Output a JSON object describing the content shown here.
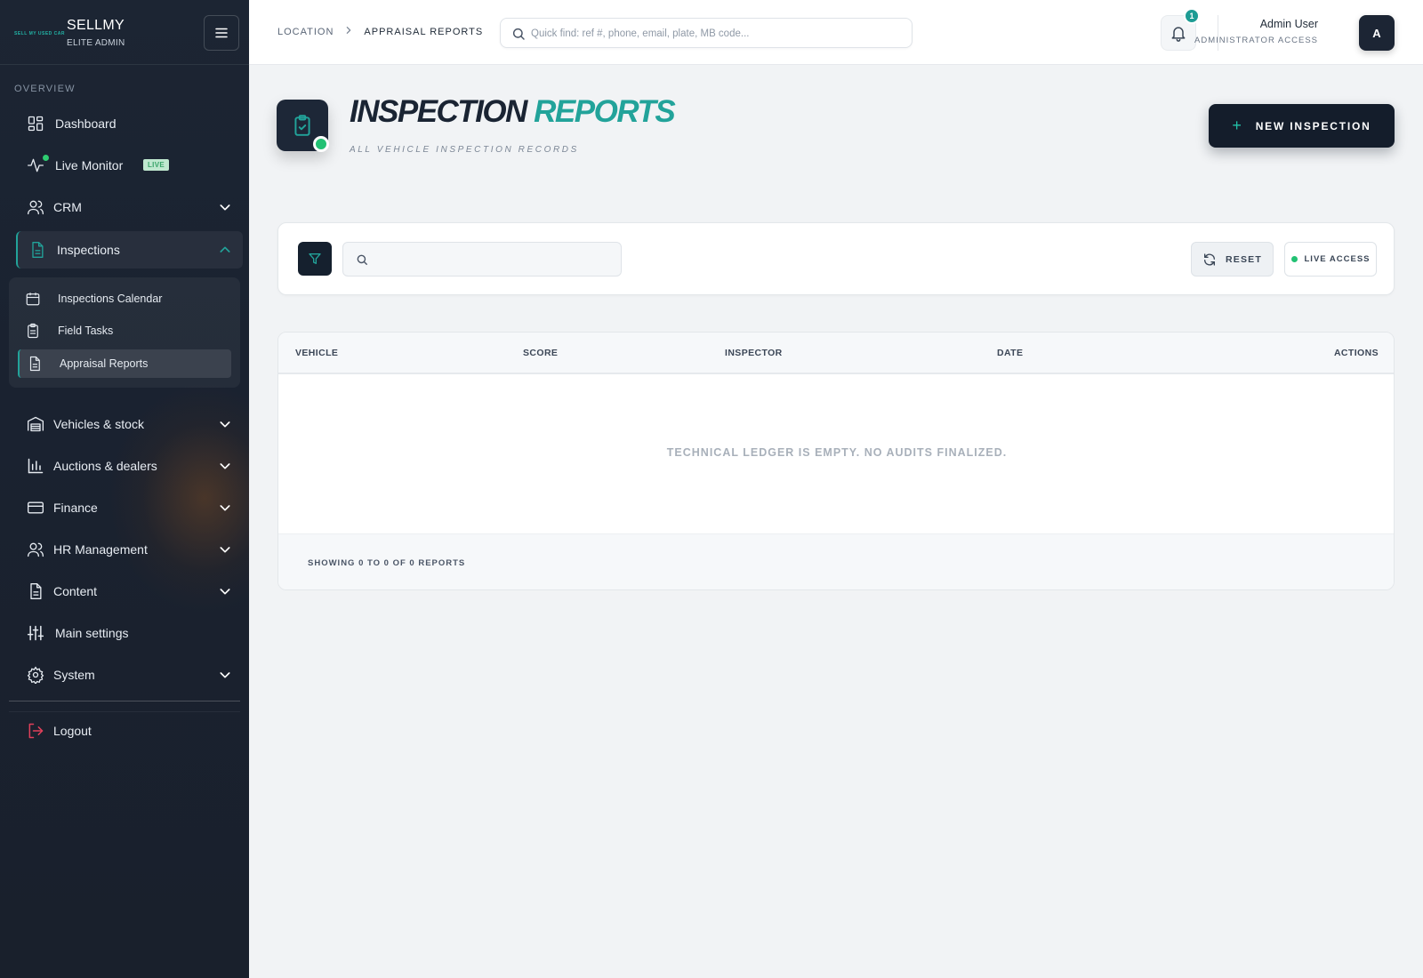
{
  "brand": {
    "logo_text": "SELL MY USED CAR",
    "name": "SELLMY",
    "subtitle": "ELITE ADMIN"
  },
  "sidebar": {
    "section_label": "OVERVIEW",
    "items": [
      {
        "label": "Dashboard",
        "icon": "dashboard-icon"
      },
      {
        "label": "Live Monitor",
        "icon": "activity-icon",
        "badge": "LIVE"
      },
      {
        "label": "CRM",
        "icon": "users-icon"
      },
      {
        "label": "Inspections",
        "icon": "document-icon",
        "expanded": true
      },
      {
        "label": "Vehicles & stock",
        "icon": "warehouse-icon"
      },
      {
        "label": "Auctions & dealers",
        "icon": "bar-chart-icon"
      },
      {
        "label": "Finance",
        "icon": "credit-card-icon"
      },
      {
        "label": "HR Management",
        "icon": "users-icon"
      },
      {
        "label": "Content",
        "icon": "document-icon"
      },
      {
        "label": "Main settings",
        "icon": "sliders-icon"
      },
      {
        "label": "System",
        "icon": "gear-icon"
      }
    ],
    "submenu": [
      {
        "label": "Inspections Calendar",
        "icon": "calendar-icon"
      },
      {
        "label": "Field Tasks",
        "icon": "clipboard-icon"
      },
      {
        "label": "Appraisal Reports",
        "icon": "document-icon",
        "active": true
      }
    ],
    "logout": "Logout"
  },
  "topbar": {
    "breadcrumb": [
      "LOCATION",
      "APPRAISAL REPORTS"
    ],
    "search_placeholder": "Quick find: ref #, phone, email, plate, MB code...",
    "notification_count": "1",
    "user_name": "Admin User",
    "user_role": "ADMINISTRATOR ACCESS",
    "avatar_initial": "A"
  },
  "page": {
    "title_part1": "INSPECTION",
    "title_part2": "REPORTS",
    "subtitle": "ALL VEHICLE INSPECTION RECORDS",
    "new_button": "NEW INSPECTION"
  },
  "filters": {
    "search_value": "",
    "reset_label": "RESET",
    "live_access_label": "LIVE ACCESS"
  },
  "table": {
    "columns": [
      "VEHICLE",
      "SCORE",
      "INSPECTOR",
      "DATE",
      "ACTIONS"
    ],
    "empty_message": "TECHNICAL LEDGER IS EMPTY. NO AUDITS FINALIZED.",
    "footer": "SHOWING 0 TO 0 OF 0 REPORTS"
  },
  "colors": {
    "accent": "#22a39a",
    "sidebar_bg": "#1c2533",
    "status_green": "#22c173",
    "logout_red": "#e0405a"
  }
}
